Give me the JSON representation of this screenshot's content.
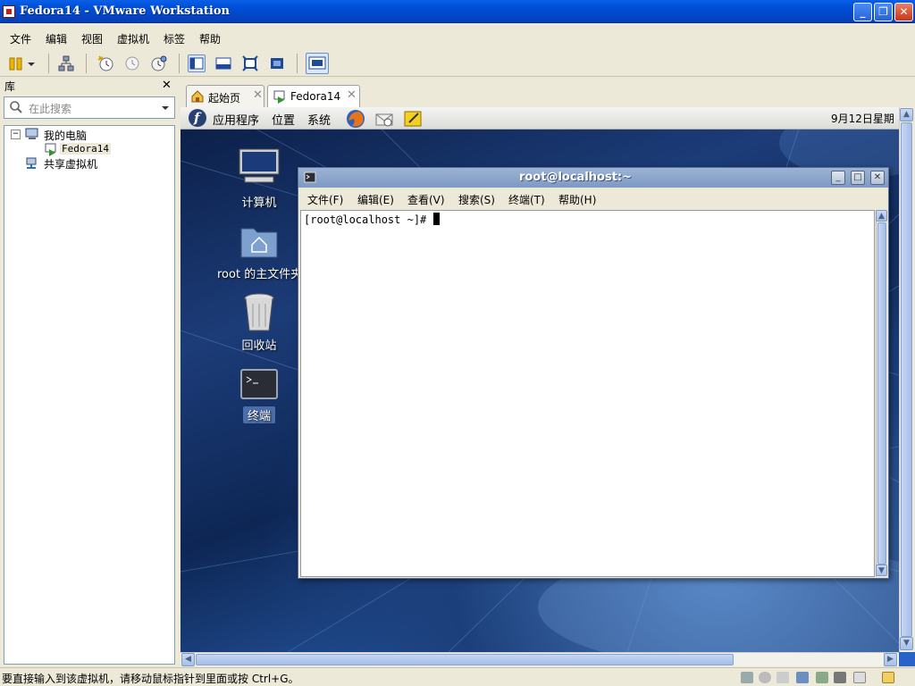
{
  "window": {
    "title": "Fedora14 - VMware Workstation",
    "minimize_label": "_",
    "maximize_label": "❐",
    "close_label": "✕"
  },
  "menubar": {
    "items": [
      "文件",
      "编辑",
      "视图",
      "虚拟机",
      "标签",
      "帮助"
    ]
  },
  "toolbar": {
    "icons": [
      "suspend-icon",
      "dropdown-arrow-icon",
      "network-icon",
      "snapshot-take-icon",
      "snapshot-revert-icon",
      "snapshot-manager-icon",
      "show-sidebar-icon",
      "show-console-icon",
      "fullscreen-icon",
      "unity-icon",
      "quick-switch-icon"
    ]
  },
  "library": {
    "title": "库",
    "close_label": "✕",
    "search_placeholder": "在此搜索",
    "tree": {
      "root_label": "我的电脑",
      "root_toggle": "⊟",
      "vm_label": "Fedora14",
      "shared_label": "共享虚拟机"
    }
  },
  "tabs": [
    {
      "label": "起始页",
      "close": "✕",
      "icon": "home-icon",
      "active": false
    },
    {
      "label": "Fedora14",
      "close": "✕",
      "icon": "vm-play-icon",
      "active": true
    }
  ],
  "guest": {
    "panel": {
      "apps": "应用程序",
      "places": "位置",
      "system": "系统",
      "clock": "9月12日星期"
    },
    "desktop_icons": [
      {
        "label": "计算机",
        "icon": "computer-icon"
      },
      {
        "label": "root 的主文件夹",
        "icon": "home-folder-icon"
      },
      {
        "label": "回收站",
        "icon": "trash-icon"
      },
      {
        "label": "终端",
        "icon": "terminal-icon"
      }
    ],
    "terminal": {
      "title": "root@localhost:~",
      "menus": [
        "文件(F)",
        "编辑(E)",
        "查看(V)",
        "搜索(S)",
        "终端(T)",
        "帮助(H)"
      ],
      "prompt": "[root@localhost ~]# "
    }
  },
  "statusbar": {
    "message": "要直接输入到该虚拟机，请移动鼠标指针到里面或按 Ctrl+G。"
  },
  "colors": {
    "xp_title_blue": "#0050d8",
    "xp_face": "#ece9d8",
    "desktop_blue": "#1c3c78",
    "terminal_title": "#7e99c2"
  }
}
